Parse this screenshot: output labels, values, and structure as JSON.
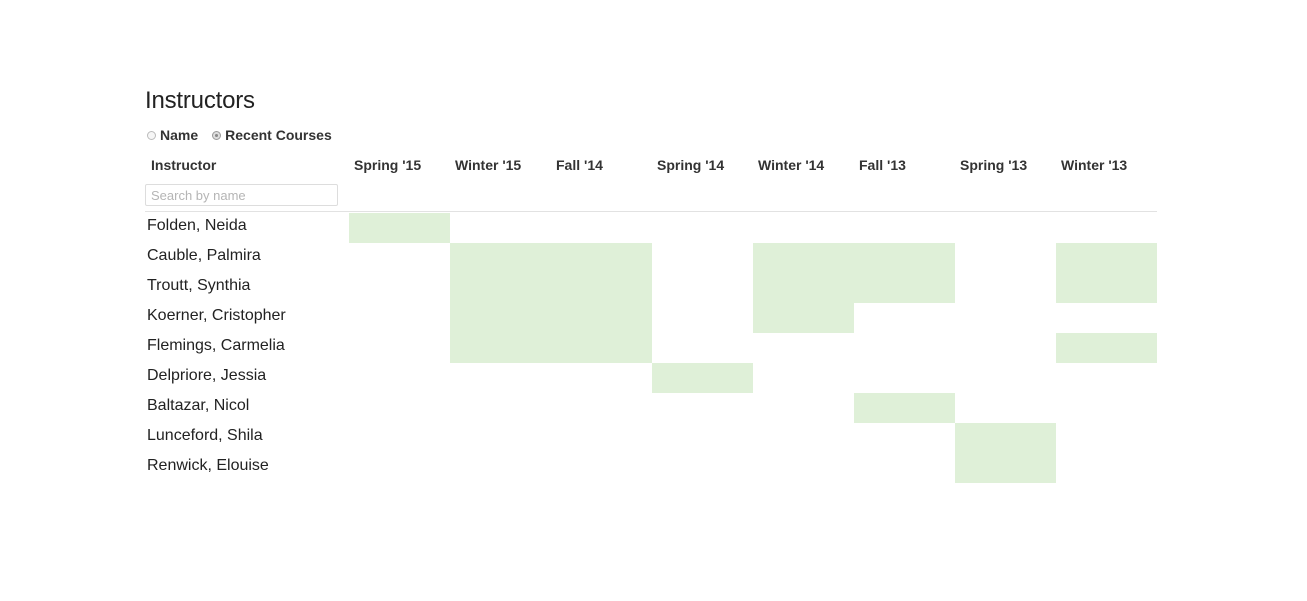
{
  "title": "Instructors",
  "sort": {
    "options": [
      {
        "label": "Name",
        "checked": false
      },
      {
        "label": "Recent Courses",
        "checked": true
      }
    ]
  },
  "table": {
    "instructor_header": "Instructor",
    "search_placeholder": "Search by name",
    "terms": [
      "Spring '15",
      "Winter '15",
      "Fall '14",
      "Spring '14",
      "Winter '14",
      "Fall '13",
      "Spring '13",
      "Winter '13"
    ],
    "highlight_color": "#dff0d8",
    "rows": [
      {
        "name": "Folden, Neida",
        "taught": [
          1,
          0,
          0,
          0,
          0,
          0,
          0,
          0
        ]
      },
      {
        "name": "Cauble, Palmira",
        "taught": [
          0,
          1,
          1,
          0,
          1,
          1,
          0,
          1
        ]
      },
      {
        "name": "Troutt, Synthia",
        "taught": [
          0,
          1,
          1,
          0,
          1,
          1,
          0,
          1
        ]
      },
      {
        "name": "Koerner, Cristopher",
        "taught": [
          0,
          1,
          1,
          0,
          1,
          0,
          0,
          0
        ]
      },
      {
        "name": "Flemings, Carmelia",
        "taught": [
          0,
          1,
          1,
          0,
          0,
          0,
          0,
          1
        ]
      },
      {
        "name": "Delpriore, Jessia",
        "taught": [
          0,
          0,
          0,
          1,
          0,
          0,
          0,
          0
        ]
      },
      {
        "name": "Baltazar, Nicol",
        "taught": [
          0,
          0,
          0,
          0,
          0,
          1,
          0,
          0
        ]
      },
      {
        "name": "Lunceford, Shila",
        "taught": [
          0,
          0,
          0,
          0,
          0,
          0,
          1,
          0
        ]
      },
      {
        "name": "Renwick, Elouise",
        "taught": [
          0,
          0,
          0,
          0,
          0,
          0,
          1,
          0
        ]
      }
    ]
  }
}
